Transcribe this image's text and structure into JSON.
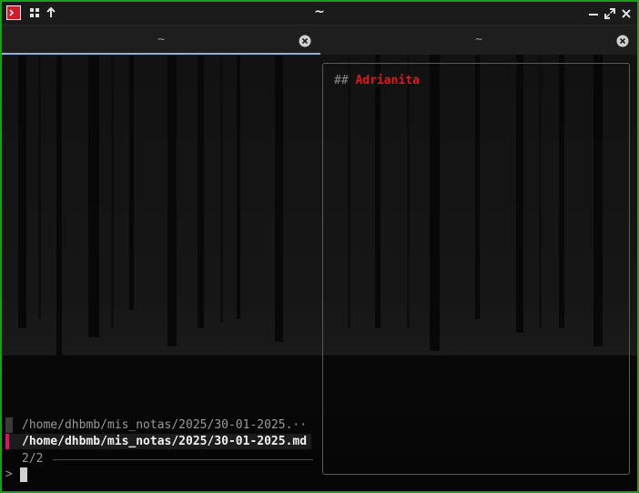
{
  "window": {
    "title": "~"
  },
  "tabs": [
    {
      "label": "~",
      "active": true
    },
    {
      "label": "~",
      "active": false
    }
  ],
  "preview": {
    "heading_marker": "##",
    "heading_text": "Adrianita"
  },
  "fzf": {
    "results": [
      {
        "text": "/home/dhbmb/mis_notas/2025/30-01-2025.",
        "truncation": "··",
        "selected": false
      },
      {
        "text": "/home/dhbmb/mis_notas/2025/30-01-2025.md",
        "selected": true
      }
    ],
    "count": "2/2",
    "prompt": ">",
    "query": ""
  },
  "colors": {
    "border": "#18a018",
    "accent_tab": "#8ab4f8",
    "selected_marker": "#d6165f",
    "heading": "#e8141d"
  },
  "icons": [
    "app-icon",
    "grid-icon",
    "arrow-up-icon",
    "minimize-icon",
    "maximize-icon",
    "close-icon",
    "tab-close-icon"
  ]
}
